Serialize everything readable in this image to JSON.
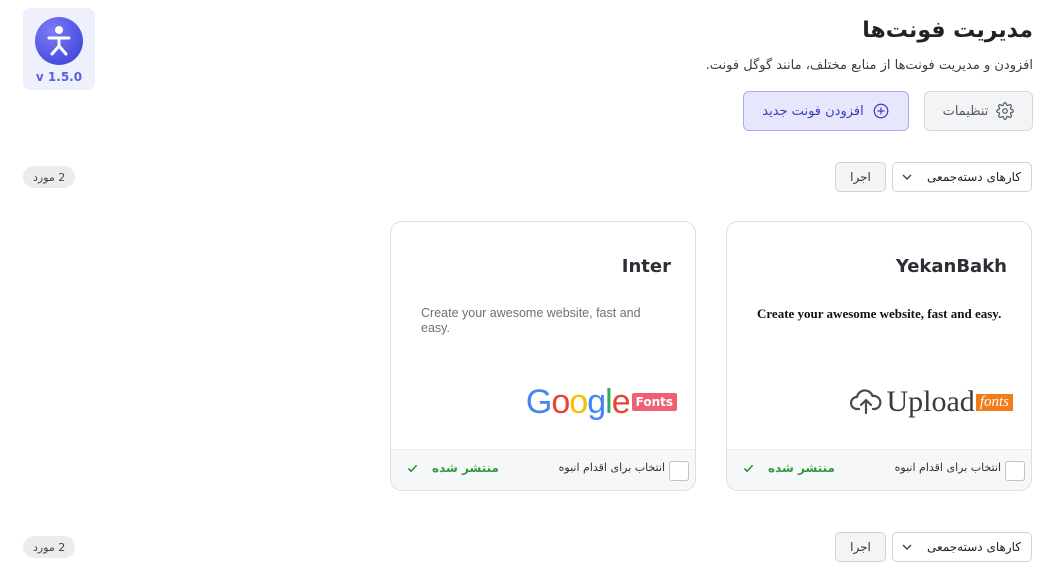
{
  "app": {
    "version": "v 1.5.0",
    "title": "مدیریت فونت‌ها",
    "subtitle": "افزودن و مدیریت فونت‌ها از منابع مختلف، مانند گوگل فونت."
  },
  "toolbar": {
    "settings_label": "تنظیمات",
    "add_font_label": "افزودن فونت جدید"
  },
  "bulk_bars": [
    {
      "select_value": "کارهای دسته‌جمعی",
      "apply_label": "اجرا",
      "count_label": "2 مورد"
    },
    {
      "select_value": "کارهای دسته‌جمعی",
      "apply_label": "اجرا",
      "count_label": "2 مورد"
    }
  ],
  "cards": [
    {
      "title": "YekanBakh",
      "preview": "Create your awesome website, fast and easy.",
      "source": "upload-fonts",
      "logo_word": "Upload",
      "logo_badge": "fonts",
      "select_label": "انتخاب برای اقدام انبوه",
      "status": "منتشر شده"
    },
    {
      "title": "Inter",
      "preview": "Create your awesome website, fast and easy.",
      "source": "google-fonts",
      "logo_word": "Google",
      "logo_badge": "Fonts",
      "select_label": "انتخاب برای اقدام انبوه",
      "status": "منتشر شده"
    }
  ],
  "colors": {
    "accent": "#4b4fe0",
    "published": "#2e9a3f",
    "google_badge": "#f06073",
    "upload_badge": "#f27b1a"
  }
}
